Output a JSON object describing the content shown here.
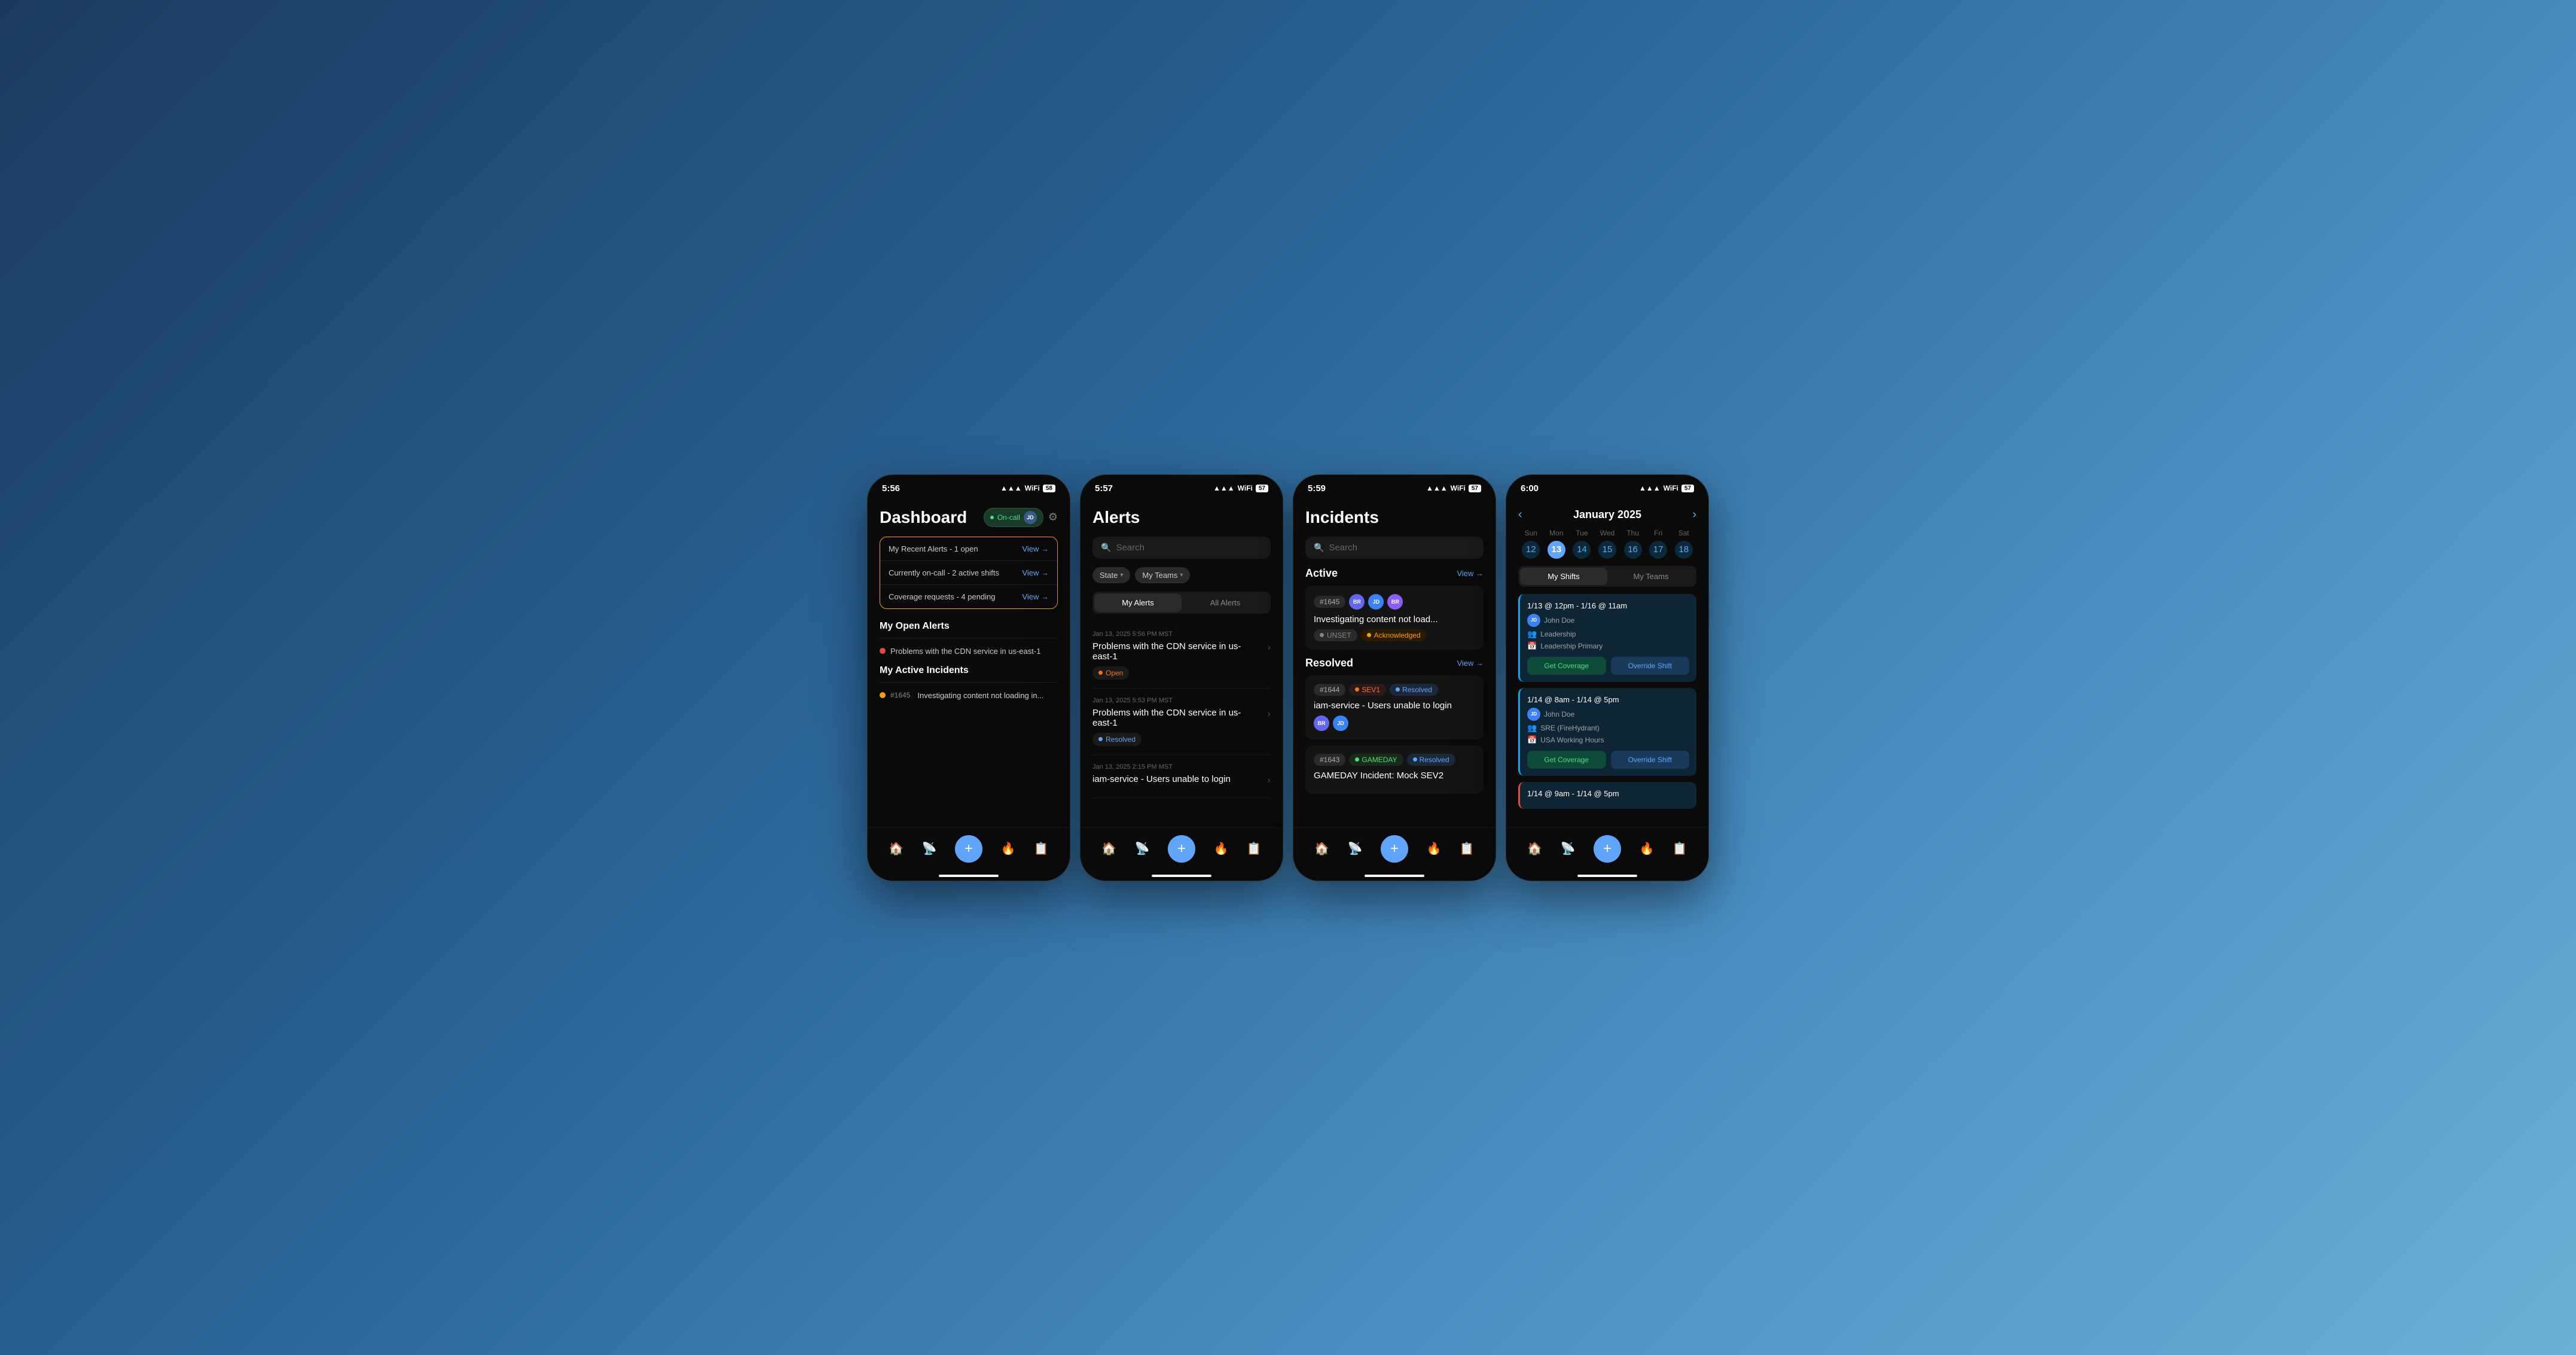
{
  "screens": {
    "dashboard": {
      "time": "5:56",
      "battery": "58",
      "title": "Dashboard",
      "oncall_label": "On-call",
      "user_initials": "JD",
      "cards": [
        {
          "text": "My Recent Alerts - 1 open",
          "link": "View →"
        },
        {
          "text": "Currently on-call - 2 active shifts",
          "link": "View →"
        },
        {
          "text": "Coverage requests - 4 pending",
          "link": "View →"
        }
      ],
      "open_alerts_title": "My Open Alerts",
      "alerts": [
        {
          "text": "Problems with the CDN service in us-east-1",
          "color": "red"
        }
      ],
      "active_incidents_title": "My Active Incidents",
      "incidents": [
        {
          "number": "#1645",
          "text": "Investigating content not loading in...",
          "color": "yellow"
        }
      ],
      "nav": [
        "🏠",
        "📡",
        "+",
        "🔥",
        "📋"
      ]
    },
    "alerts": {
      "time": "5:57",
      "battery": "57",
      "title": "Alerts",
      "search_placeholder": "Search",
      "filters": [
        "State",
        "My Teams"
      ],
      "tabs": [
        "My Alerts",
        "All Alerts"
      ],
      "active_tab": 0,
      "entries": [
        {
          "date": "Jan 13, 2025 5:56 PM MST",
          "title": "Problems with the CDN service in us-east-1",
          "status": "Open",
          "status_type": "open"
        },
        {
          "date": "Jan 13, 2025 5:53 PM MST",
          "title": "Problems with the CDN service in us-east-1",
          "status": "Resolved",
          "status_type": "resolved"
        },
        {
          "date": "Jan 13, 2025 2:15 PM MST",
          "title": "iam-service - Users unable to login",
          "status": "",
          "status_type": "none"
        }
      ],
      "nav": [
        "🏠",
        "📡",
        "+",
        "🔥",
        "📋"
      ]
    },
    "incidents": {
      "time": "5:59",
      "battery": "57",
      "title": "Incidents",
      "search_placeholder": "Search",
      "active_label": "Active",
      "resolved_label": "Resolved",
      "view_link": "View →",
      "active_incidents": [
        {
          "number": "#1645",
          "assignees": [
            "BR",
            "JD",
            "BR"
          ],
          "assignee_colors": [
            "#6366f1",
            "#3b82f6",
            "#8b5cf6"
          ],
          "title": "Investigating content not load...",
          "badges": [
            "UNSET",
            "Acknowledged"
          ]
        }
      ],
      "resolved_incidents": [
        {
          "number": "#1644",
          "sev": "SEV1",
          "status": "Resolved",
          "assignees": [
            "BR",
            "JD"
          ],
          "assignee_colors": [
            "#6366f1",
            "#3b82f6"
          ],
          "title": "iam-service - Users unable to login"
        },
        {
          "number": "#1643",
          "sev": "GAMEDAY",
          "status": "Resolved",
          "assignees": [],
          "title": "GAMEDAY Incident: Mock SEV2"
        }
      ],
      "nav": [
        "🏠",
        "📡",
        "+",
        "🔥",
        "📋"
      ]
    },
    "calendar": {
      "time": "6:00",
      "battery": "57",
      "month": "January 2025",
      "day_labels": [
        "Sun",
        "Mon",
        "Tue",
        "Wed",
        "Thu",
        "Fri",
        "Sat"
      ],
      "week_dates": [
        12,
        13,
        14,
        15,
        16,
        17,
        18
      ],
      "today": 13,
      "range_start": 12,
      "range_end": 18,
      "tabs": [
        "My Shifts",
        "My Teams"
      ],
      "active_tab": 0,
      "shifts": [
        {
          "time": "1/13 @ 12pm - 1/16 @ 11am",
          "user": "John Doe",
          "team": "Leadership",
          "schedule": "Leadership Primary",
          "actions": [
            "Get Coverage",
            "Override Shift"
          ],
          "border": "teal"
        },
        {
          "time": "1/14 @ 8am - 1/14 @ 5pm",
          "user": "John Doe",
          "team": "SRE (FireHydrant)",
          "schedule": "USA Working Hours",
          "actions": [
            "Get Coverage",
            "Override Shift"
          ],
          "border": "teal"
        },
        {
          "time": "1/14 @ 9am - 1/14 @ 5pm",
          "user": "",
          "team": "",
          "schedule": "",
          "actions": [],
          "border": "red"
        }
      ],
      "nav": [
        "🏠",
        "📡",
        "+",
        "🔥",
        "📋"
      ]
    }
  }
}
